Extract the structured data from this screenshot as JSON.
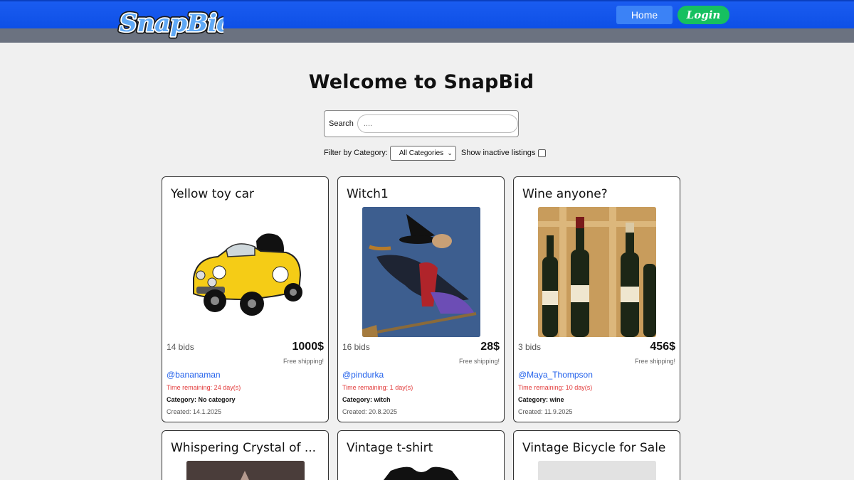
{
  "header": {
    "logo_text": "SnapBid",
    "nav": {
      "home": "Home",
      "login": "Login"
    }
  },
  "main": {
    "title": "Welcome to SnapBid",
    "search": {
      "label": "Search",
      "placeholder": "...."
    },
    "filter": {
      "label": "Filter by Category:",
      "selected": "All Categories",
      "inactive_label": "Show inactive listings",
      "inactive_checked": false
    }
  },
  "listings": [
    {
      "title": "Yellow toy car",
      "bids": "14 bids",
      "price": "1000$",
      "shipping": "Free shipping!",
      "seller": "@bananaman",
      "remaining": "Time remaining: 24 day(s)",
      "category_label": "Category:",
      "category": "No category",
      "created": "Created: 14.1.2025"
    },
    {
      "title": "Witch1",
      "bids": "16 bids",
      "price": "28$",
      "shipping": "Free shipping!",
      "seller": "@pindurka",
      "remaining": "Time remaining: 1 day(s)",
      "category_label": "Category:",
      "category": "witch",
      "created": "Created: 20.8.2025"
    },
    {
      "title": "Wine anyone?",
      "bids": "3 bids",
      "price": "456$",
      "shipping": "Free shipping!",
      "seller": "@Maya_Thompson",
      "remaining": "Time remaining: 10 day(s)",
      "category_label": "Category:",
      "category": "wine",
      "created": "Created: 11.9.2025"
    },
    {
      "title": "Whispering Crystal of ..."
    },
    {
      "title": "Vintage t-shirt"
    },
    {
      "title": "Vintage Bicycle for Sale"
    }
  ],
  "colors": {
    "header_blue": "#0d4fe6",
    "subbar_gray": "#6b7280",
    "login_green": "#16c060",
    "link_blue": "#2563eb",
    "warn_red": "#e23b3b"
  }
}
